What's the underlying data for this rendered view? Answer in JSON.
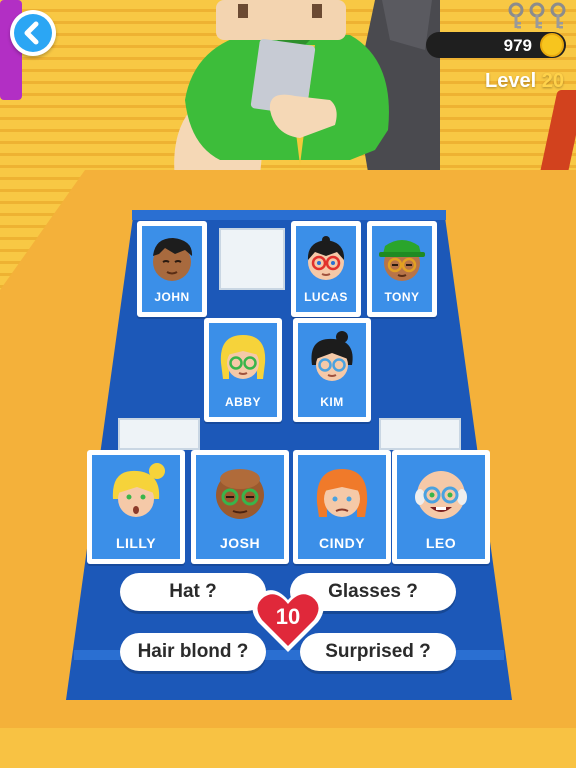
{
  "hud": {
    "coins": "979",
    "level_label": "Level",
    "level_number": "20",
    "keys_count": 3,
    "keys_collected": 0
  },
  "board": {
    "back_row": [
      {
        "name": "JOHN"
      },
      {
        "name": "LUCAS"
      },
      {
        "name": "TONY"
      }
    ],
    "middle_row": [
      {
        "name": "ABBY"
      },
      {
        "name": "KIM"
      }
    ],
    "front_row": [
      {
        "name": "LILLY"
      },
      {
        "name": "JOSH"
      },
      {
        "name": "CINDY"
      },
      {
        "name": "LEO"
      }
    ]
  },
  "questions": {
    "hat": "Hat ?",
    "glasses": "Glasses ?",
    "hair_blond": "Hair blond ?",
    "surprised": "Surprised ?"
  },
  "lives": "10",
  "colors": {
    "board_blue": "#1d5dbf",
    "card_blue": "#3b8fe8",
    "heart_red": "#e0283a",
    "back_button": "#2ba6f4",
    "coin_gold": "#f7c51e"
  },
  "icons": {
    "back": "chevron-left-icon",
    "coin": "coin-icon",
    "keys": "key-icon",
    "lives": "heart-icon"
  }
}
